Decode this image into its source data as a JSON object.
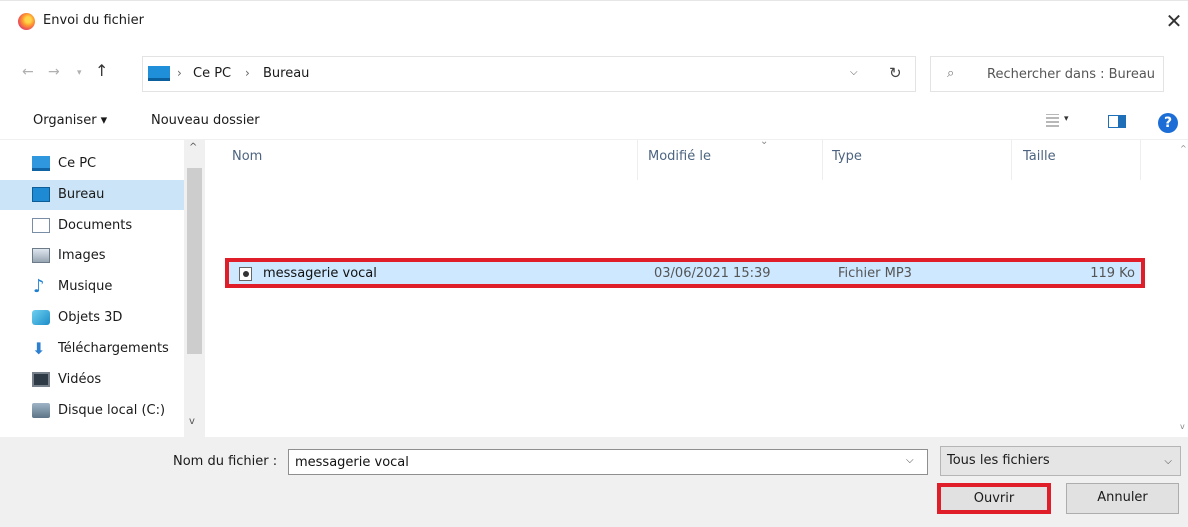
{
  "window": {
    "title": "Envoi du fichier",
    "close_glyph": "✕"
  },
  "nav": {
    "back": "←",
    "forward": "→",
    "recent": "▾",
    "up": "↑",
    "refresh": "↻",
    "dropdown": "⌵"
  },
  "breadcrumb": {
    "items": [
      "Ce PC",
      "Bureau"
    ],
    "sep": "›"
  },
  "search": {
    "placeholder": "Rechercher dans : Bureau",
    "icon": "⌕"
  },
  "toolbar": {
    "organiser": "Organiser ▾",
    "new_folder": "Nouveau dossier",
    "view_caret": "▾",
    "help": "?"
  },
  "sidebar": {
    "items": [
      {
        "label": "Ce PC",
        "icon": "pc-icon"
      },
      {
        "label": "Bureau",
        "icon": "desktop-icon"
      },
      {
        "label": "Documents",
        "icon": "documents-icon"
      },
      {
        "label": "Images",
        "icon": "images-icon"
      },
      {
        "label": "Musique",
        "icon": "music-icon"
      },
      {
        "label": "Objets 3D",
        "icon": "objects-3d-icon"
      },
      {
        "label": "Téléchargements",
        "icon": "downloads-icon"
      },
      {
        "label": "Vidéos",
        "icon": "videos-icon"
      },
      {
        "label": "Disque local (C:)",
        "icon": "disk-icon"
      }
    ],
    "selected": "Bureau",
    "scroll_up": "^",
    "scroll_down": "v"
  },
  "columns": {
    "name": "Nom",
    "modified": "Modifié le",
    "type": "Type",
    "size": "Taille",
    "sort_chevron": "⌄"
  },
  "files": [
    {
      "name": "messagerie vocal",
      "modified": "03/06/2021 15:39",
      "type": "Fichier MP3",
      "size": "119 Ko"
    }
  ],
  "footer": {
    "filename_label": "Nom du fichier :",
    "filename_value": "messagerie vocal",
    "filter": "Tous les fichiers",
    "open": "Ouvrir",
    "cancel": "Annuler",
    "arrow": "⌵"
  },
  "colors": {
    "selection": "#cde8ff",
    "highlight_border": "#e01e2a",
    "sidebar_selected": "#cce4f7"
  }
}
